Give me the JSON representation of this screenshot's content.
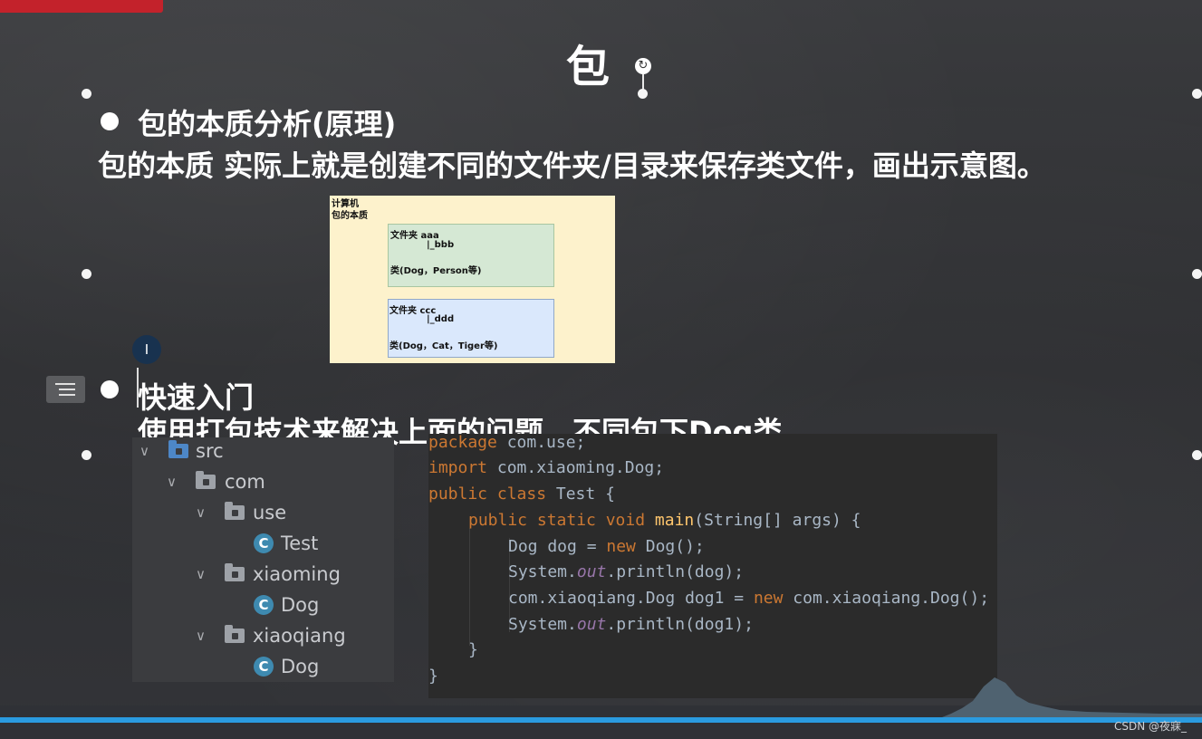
{
  "slide": {
    "title": "包",
    "bullet1_heading": "包的本质分析(原理)",
    "bullet1_desc": "包的本质 实际上就是创建不同的文件夹/目录来保存类文件，画出示意图。",
    "bullet2_heading": "快速入门",
    "bullet2_desc": "使用打包技术来解决上面的问题，不同包下Dog类"
  },
  "diagram": {
    "label1": "计算机",
    "label2": "包的本质",
    "box1": {
      "line1": "文件夹 aaa",
      "line2": "|_bbb",
      "line3": "类(Dog，Person等)"
    },
    "box2": {
      "line1": "文件夹 ccc",
      "line2": "|_ddd",
      "line3": "类(Dog，Cat，Tiger等)"
    }
  },
  "project_tree": {
    "nodes": [
      {
        "label": "src",
        "icon": "source-folder-icon"
      },
      {
        "label": "com",
        "icon": "folder-icon"
      },
      {
        "label": "use",
        "icon": "folder-icon"
      },
      {
        "label": "Test",
        "icon": "class-icon"
      },
      {
        "label": "xiaoming",
        "icon": "folder-icon"
      },
      {
        "label": "Dog",
        "icon": "class-icon"
      },
      {
        "label": "xiaoqiang",
        "icon": "folder-icon"
      },
      {
        "label": "Dog",
        "icon": "class-icon"
      }
    ],
    "class_icon_letter": "C"
  },
  "code": {
    "line1_kw": "package",
    "line1_rest": " com.use;",
    "line2_kw": "import",
    "line2_rest": " com.xiaoming.Dog;",
    "line3_kw": "public class",
    "line3_rest": " Test {",
    "line4_kw": "public static void",
    "line4_fn": "main",
    "line4_rest": "(String[] args) {",
    "line5_a": "Dog dog = ",
    "line5_kw": "new",
    "line5_b": " Dog();",
    "line6_a": "System.",
    "line6_field": "out",
    "line6_b": ".println(dog);",
    "line7_a": "com.xiaoqiang.Dog dog1 = ",
    "line7_kw": "new",
    "line7_b": " com.xiaoqiang.Dog();",
    "line8_a": "System.",
    "line8_field": "out",
    "line8_b": ".println(dog1);",
    "line9": "}",
    "line10": "}"
  },
  "watermark": "CSDN @夜寐_",
  "colors": {
    "keyword": "#cc7832",
    "method": "#ffc66d",
    "field": "#9876aa",
    "accent_blue": "#2a9be0",
    "red_tab": "#c3222b"
  }
}
